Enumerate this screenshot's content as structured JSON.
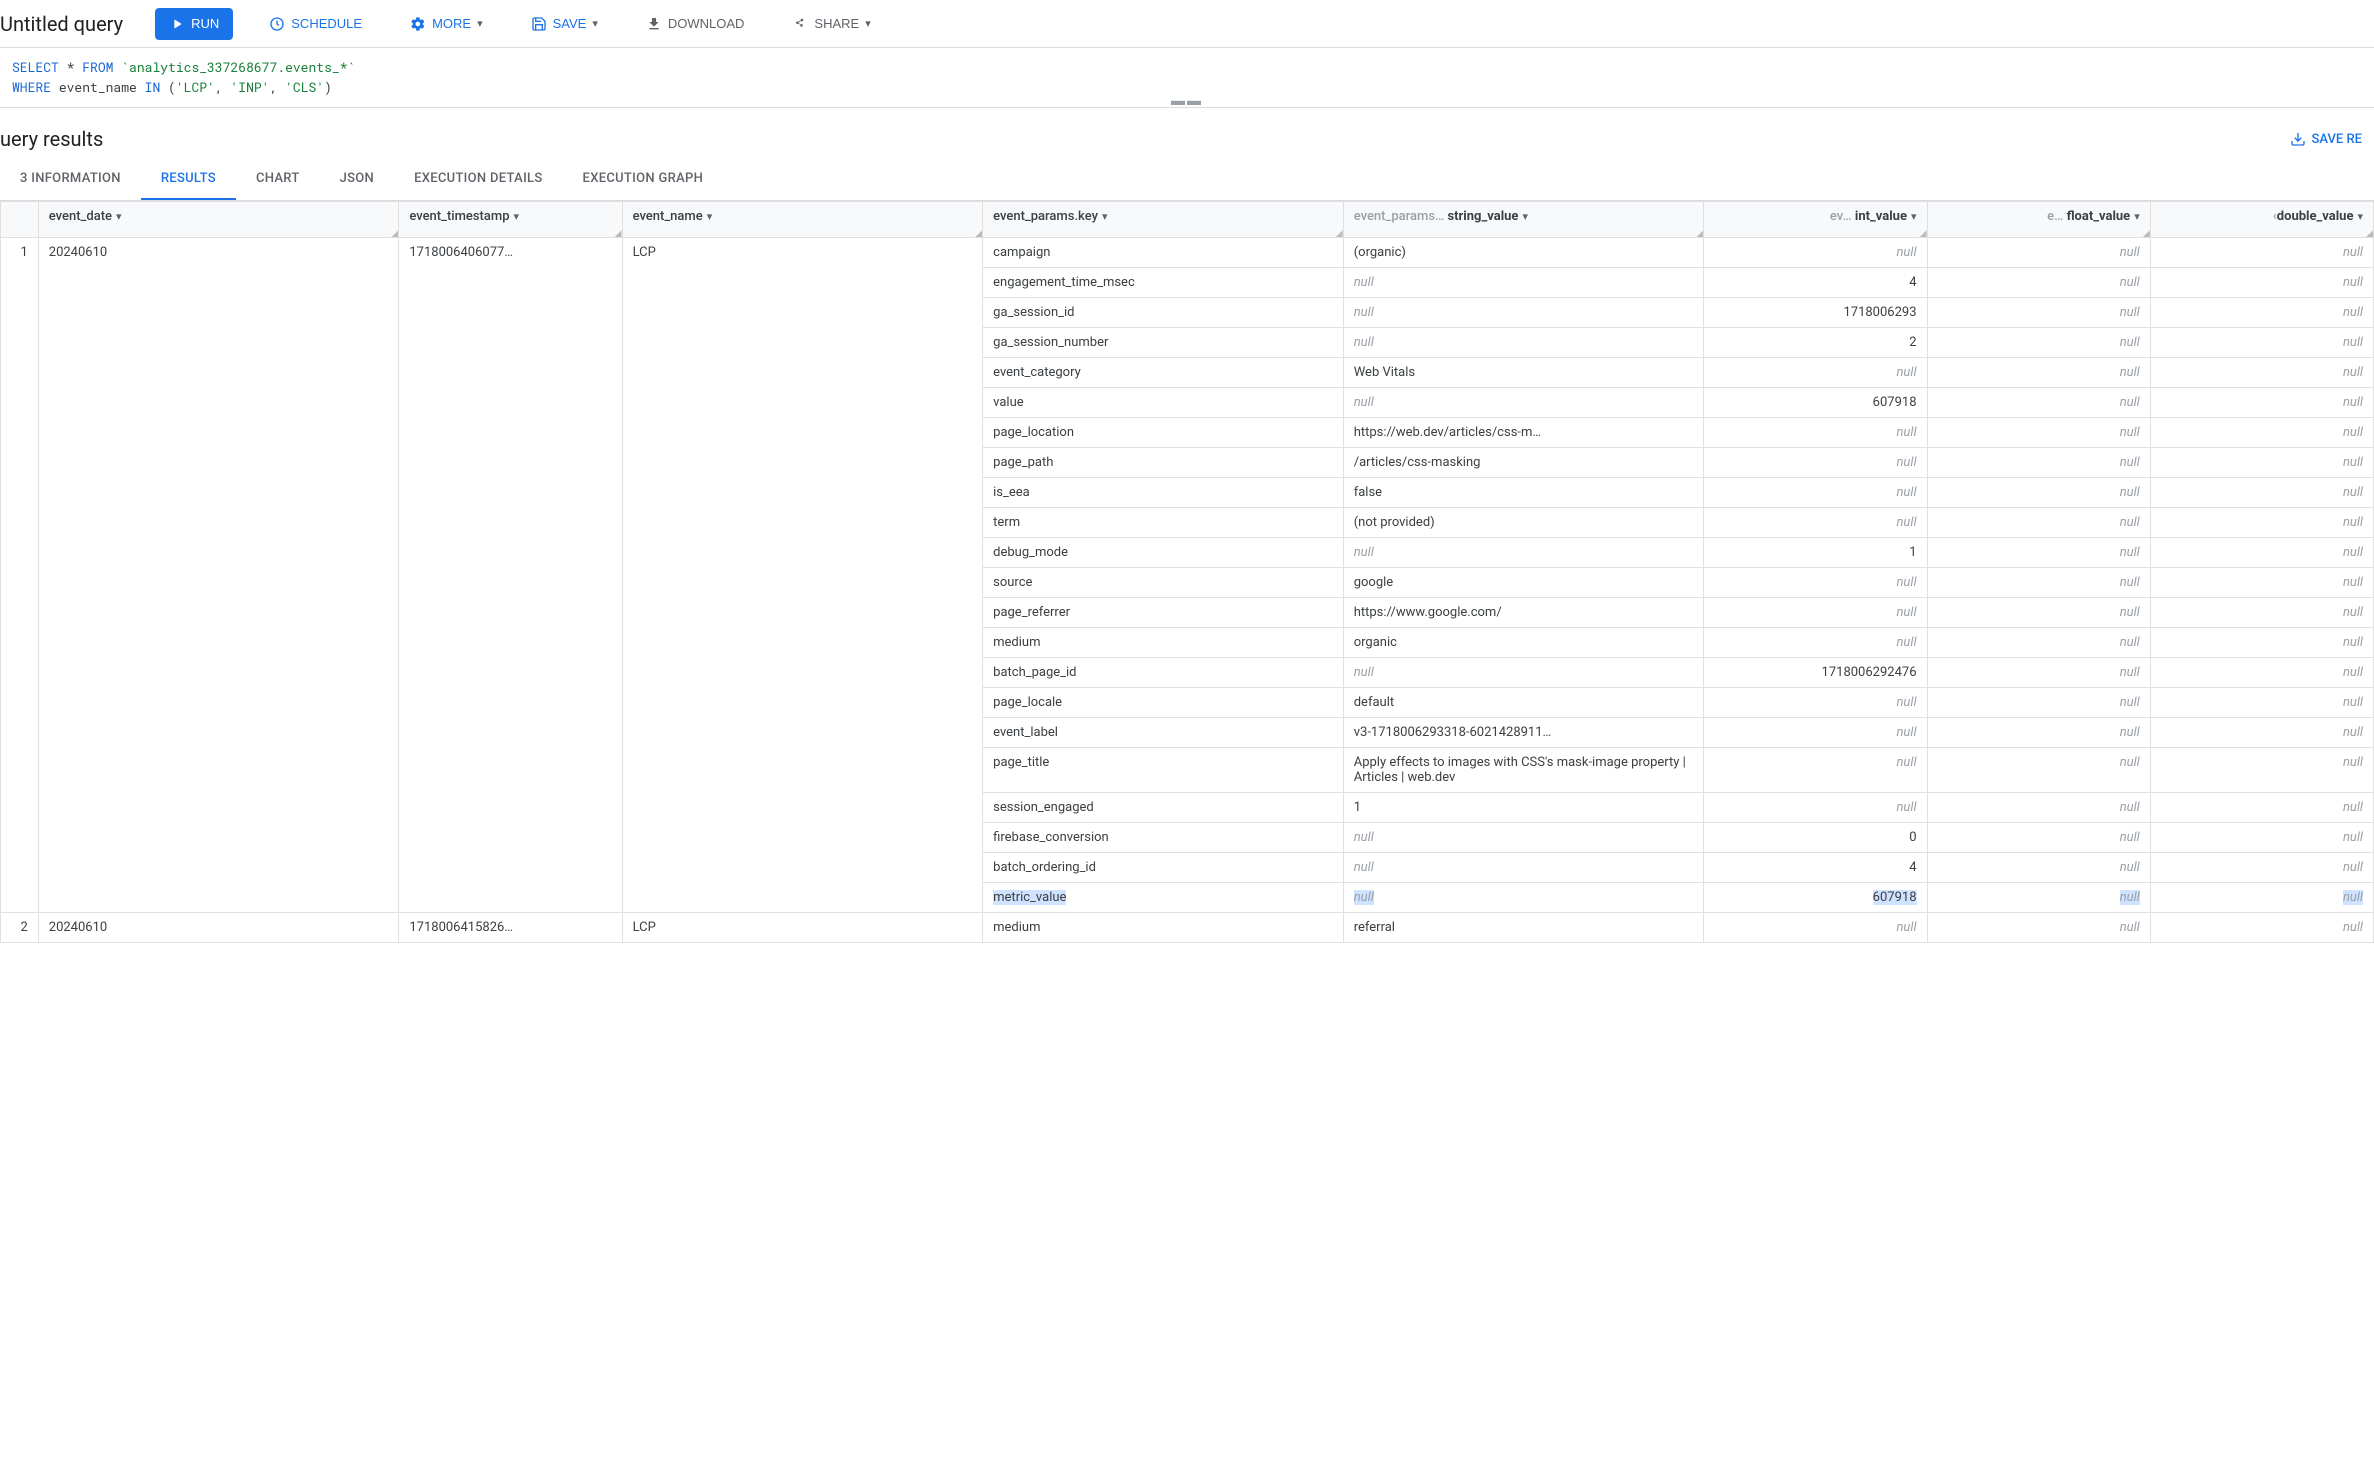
{
  "header": {
    "title": "Untitled query",
    "run": "RUN",
    "schedule": "SCHEDULE",
    "more": "MORE",
    "save": "SAVE",
    "download": "DOWNLOAD",
    "share": "SHARE"
  },
  "sql": {
    "line1_select": "SELECT",
    "line1_star": " * ",
    "line1_from": "FROM",
    "line1_table": " `analytics_337268677.events_*`",
    "line2_where": "WHERE",
    "line2_col": " event_name ",
    "line2_in": "IN",
    "line2_open": " (",
    "line2_v1": "'LCP'",
    "line2_c1": ", ",
    "line2_v2": "'INP'",
    "line2_c2": ", ",
    "line2_v3": "'CLS'",
    "line2_close": ")"
  },
  "results": {
    "title": "uery results",
    "save_results": "SAVE RE"
  },
  "tabs": [
    "3 INFORMATION",
    "RESULTS",
    "CHART",
    "JSON",
    "EXECUTION DETAILS",
    "EXECUTION GRAPH"
  ],
  "columns": {
    "row": "",
    "event_date": "event_date",
    "event_timestamp": "event_timestamp",
    "event_name": "event_name",
    "key": "event_params.key",
    "string_value_prefix": "event_params…",
    "string_value": "string_value",
    "int_value_prefix": "ev…",
    "int_value": "int_value",
    "float_value_prefix": "e…",
    "float_value": "float_value",
    "double_value_prefix": "‹",
    "double_value": "double_value"
  },
  "rows": [
    {
      "idx": "1",
      "event_date": "20240610",
      "event_timestamp": "1718006406077…",
      "event_name": "LCP",
      "params": [
        {
          "key": "campaign",
          "sv": "(organic)",
          "iv": null,
          "fv": null,
          "dv": null
        },
        {
          "key": "engagement_time_msec",
          "sv": null,
          "iv": "4",
          "fv": null,
          "dv": null
        },
        {
          "key": "ga_session_id",
          "sv": null,
          "iv": "1718006293",
          "fv": null,
          "dv": null
        },
        {
          "key": "ga_session_number",
          "sv": null,
          "iv": "2",
          "fv": null,
          "dv": null
        },
        {
          "key": "event_category",
          "sv": "Web Vitals",
          "iv": null,
          "fv": null,
          "dv": null
        },
        {
          "key": "value",
          "sv": null,
          "iv": "607918",
          "fv": null,
          "dv": null
        },
        {
          "key": "page_location",
          "sv": "https://web.dev/articles/css-m…",
          "iv": null,
          "fv": null,
          "dv": null
        },
        {
          "key": "page_path",
          "sv": "/articles/css-masking",
          "iv": null,
          "fv": null,
          "dv": null
        },
        {
          "key": "is_eea",
          "sv": "false",
          "iv": null,
          "fv": null,
          "dv": null
        },
        {
          "key": "term",
          "sv": "(not provided)",
          "iv": null,
          "fv": null,
          "dv": null
        },
        {
          "key": "debug_mode",
          "sv": null,
          "iv": "1",
          "fv": null,
          "dv": null
        },
        {
          "key": "source",
          "sv": "google",
          "iv": null,
          "fv": null,
          "dv": null
        },
        {
          "key": "page_referrer",
          "sv": "https://www.google.com/",
          "iv": null,
          "fv": null,
          "dv": null
        },
        {
          "key": "medium",
          "sv": "organic",
          "iv": null,
          "fv": null,
          "dv": null
        },
        {
          "key": "batch_page_id",
          "sv": null,
          "iv": "1718006292476",
          "fv": null,
          "dv": null
        },
        {
          "key": "page_locale",
          "sv": "default",
          "iv": null,
          "fv": null,
          "dv": null
        },
        {
          "key": "event_label",
          "sv": "v3-1718006293318-6021428911…",
          "iv": null,
          "fv": null,
          "dv": null
        },
        {
          "key": "page_title",
          "sv": "Apply effects to images with CSS's mask-image property  |  Articles  |  web.dev",
          "iv": null,
          "fv": null,
          "dv": null,
          "wrap": true
        },
        {
          "key": "session_engaged",
          "sv": "1",
          "iv": null,
          "fv": null,
          "dv": null
        },
        {
          "key": "firebase_conversion",
          "sv": null,
          "iv": "0",
          "fv": null,
          "dv": null
        },
        {
          "key": "batch_ordering_id",
          "sv": null,
          "iv": "4",
          "fv": null,
          "dv": null
        },
        {
          "key": "metric_value",
          "sv": null,
          "iv": "607918",
          "fv": null,
          "dv": null,
          "highlight": true
        }
      ]
    },
    {
      "idx": "2",
      "event_date": "20240610",
      "event_timestamp": "1718006415826…",
      "event_name": "LCP",
      "params": [
        {
          "key": "medium",
          "sv": "referral",
          "iv": null,
          "fv": null,
          "dv": null
        }
      ]
    }
  ],
  "null_text": "null"
}
